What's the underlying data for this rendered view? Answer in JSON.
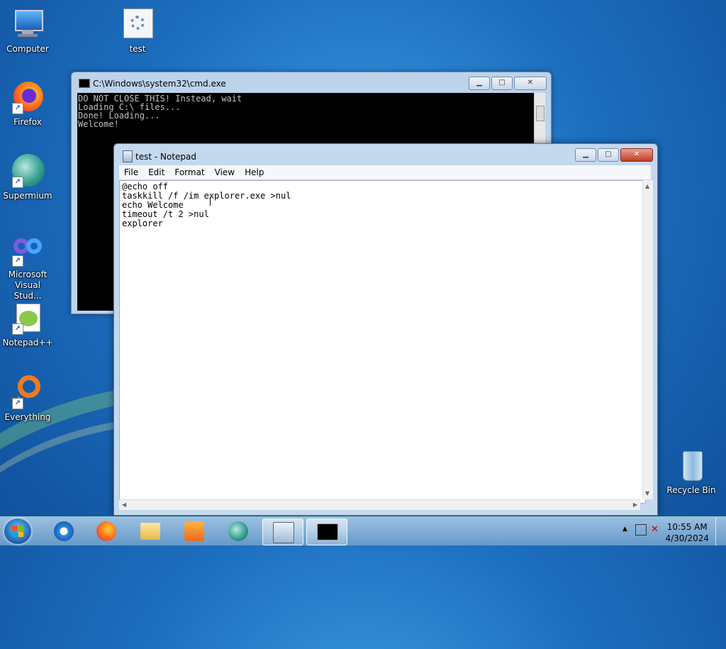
{
  "desktop": {
    "icons": [
      {
        "label": "Computer"
      },
      {
        "label": "test"
      },
      {
        "label": "Firefox"
      },
      {
        "label": "Supermium"
      },
      {
        "label": "Microsoft Visual Stud..."
      },
      {
        "label": "Notepad++"
      },
      {
        "label": "Everything"
      },
      {
        "label": "Recycle Bin"
      }
    ]
  },
  "cmd_window": {
    "title": "C:\\Windows\\system32\\cmd.exe",
    "console_text": "DO NOT CLOSE THIS! Instead, wait\nLoading C:\\ files...\nDone! Loading...\nWelcome!"
  },
  "notepad_window": {
    "title": "test - Notepad",
    "menu": [
      "File",
      "Edit",
      "Format",
      "View",
      "Help"
    ],
    "content": "@echo off\ntaskkill /f /im explorer.exe >nul\necho Welcome\ntimeout /t 2 >nul\nexplorer"
  },
  "window_controls": {
    "minimize": "▁",
    "maximize": "□",
    "close": "✕"
  },
  "taskbar": {
    "clock_time": "10:55 AM",
    "clock_date": "4/30/2024"
  },
  "colors": {
    "desktop_bg": "#1d6fc0",
    "console_bg": "#000000",
    "close_button": "#c43c22"
  }
}
